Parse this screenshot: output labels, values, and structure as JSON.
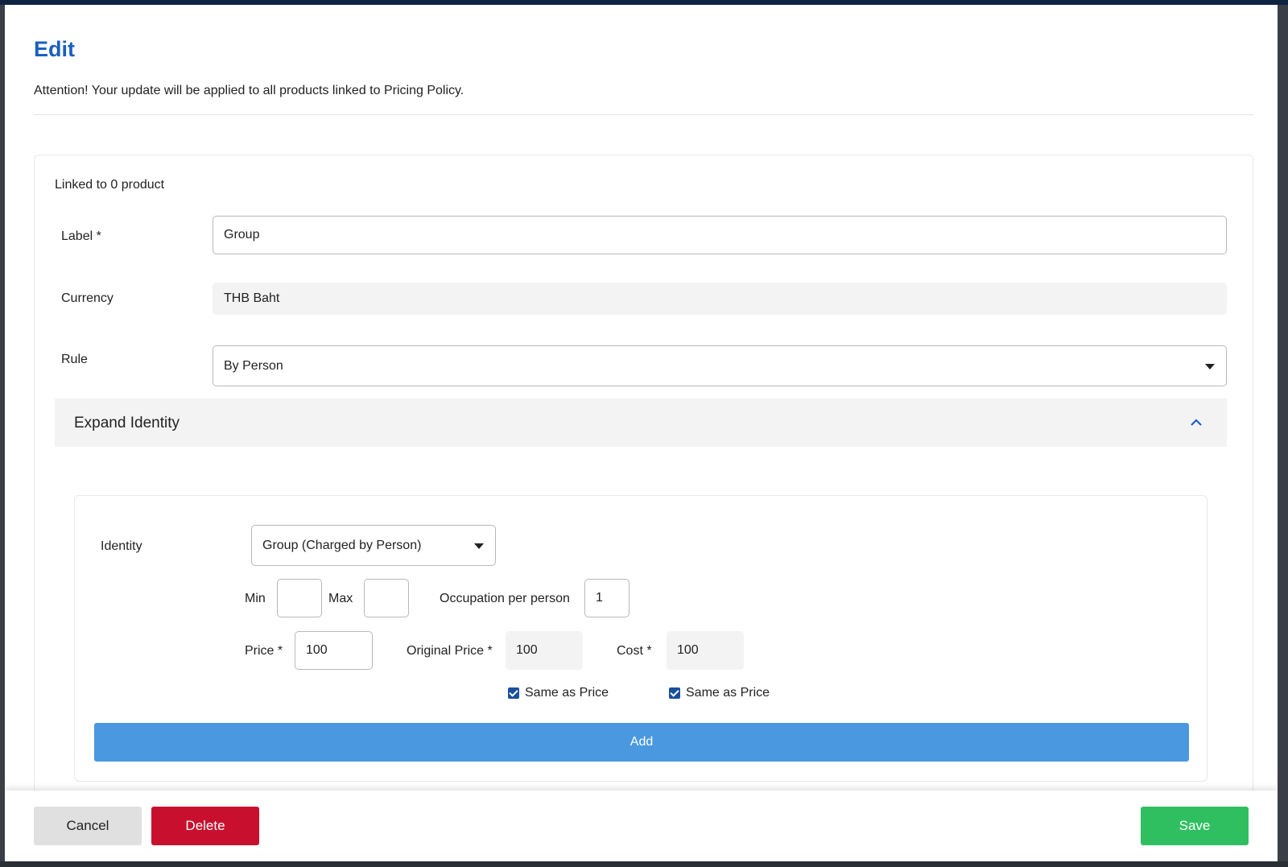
{
  "modal": {
    "title": "Edit",
    "attention": "Attention! Your update will be applied to all products linked to Pricing Policy."
  },
  "form": {
    "linked_text": "Linked to 0 product",
    "label_field": {
      "label": "Label *",
      "value": "Group"
    },
    "currency_field": {
      "label": "Currency",
      "value": "THB Baht"
    },
    "rule_field": {
      "label": "Rule",
      "value": "By Person"
    }
  },
  "expand_section": {
    "title": "Expand Identity",
    "expanded": true
  },
  "identity": {
    "label": "Identity",
    "selected": "Group (Charged by Person)",
    "min_label": "Min",
    "min_value": "",
    "max_label": "Max",
    "max_value": "",
    "occupation_label": "Occupation per person",
    "occupation_value": "1",
    "price_label": "Price *",
    "price_value": "100",
    "original_price_label": "Original Price *",
    "original_price_value": "100",
    "cost_label": "Cost *",
    "cost_value": "100",
    "same_as_price_label_1": "Same as Price",
    "same_as_price_label_2": "Same as Price",
    "add_label": "Add"
  },
  "footer": {
    "cancel_label": "Cancel",
    "delete_label": "Delete",
    "save_label": "Save"
  },
  "colors": {
    "title": "#1a5fc0",
    "add": "#4a98e0",
    "delete": "#c8102e",
    "save": "#2fbf60",
    "checkbox": "#1a4f9c"
  }
}
